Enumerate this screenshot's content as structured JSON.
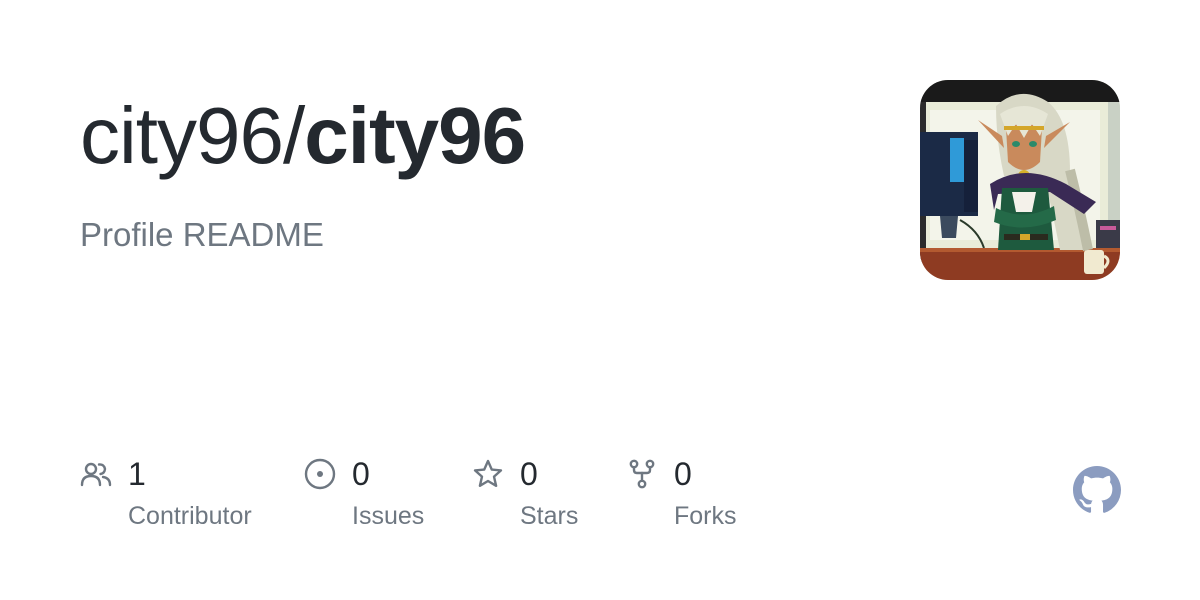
{
  "repo": {
    "owner": "city96/",
    "name": "city96",
    "description": "Profile README"
  },
  "stats": {
    "contributors": {
      "count": "1",
      "label": "Contributor"
    },
    "issues": {
      "count": "0",
      "label": "Issues"
    },
    "stars": {
      "count": "0",
      "label": "Stars"
    },
    "forks": {
      "count": "0",
      "label": "Forks"
    }
  },
  "icons": {
    "contributors": "people-icon",
    "issues": "issue-opened-icon",
    "stars": "star-icon",
    "forks": "repo-forked-icon",
    "brand": "github-logo-icon"
  },
  "colors": {
    "title": "#24292f",
    "muted": "#6e7781",
    "icon": "#6e7781",
    "brand_logo": "#8b9cc0",
    "background": "#ffffff"
  }
}
